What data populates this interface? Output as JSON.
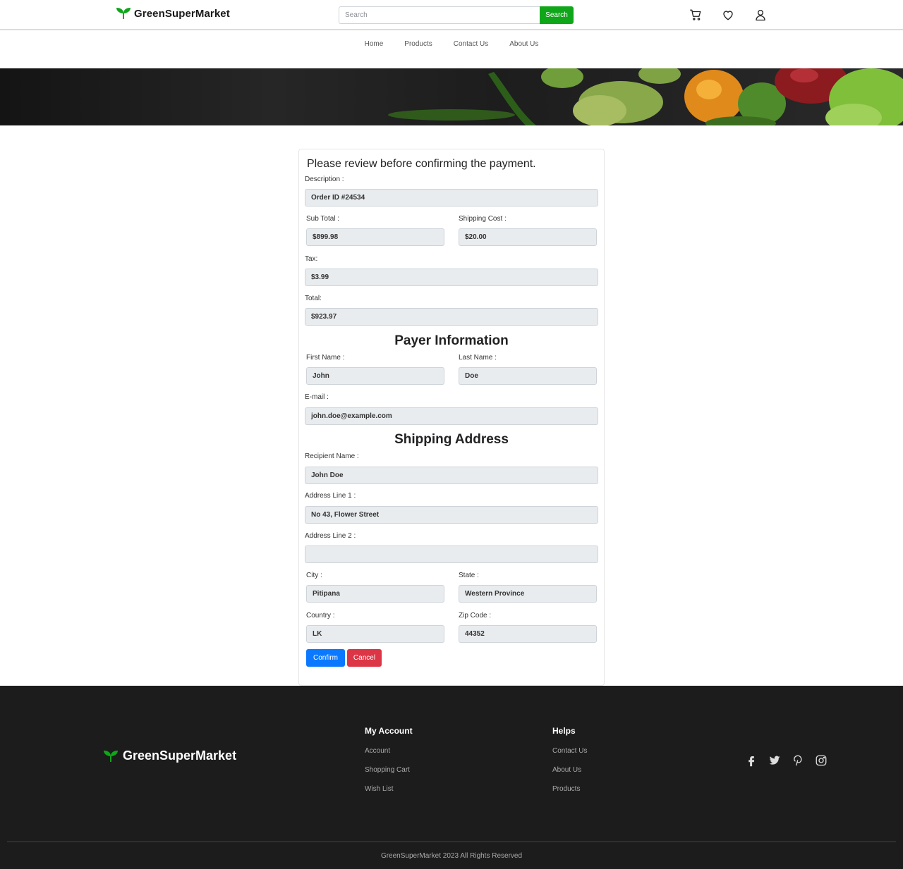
{
  "header": {
    "brand": "GreenSuperMarket",
    "search_placeholder": "Search",
    "search_button": "Search",
    "icons": [
      "cart-icon",
      "heart-icon",
      "user-icon"
    ]
  },
  "nav": {
    "items": [
      "Home",
      "Products",
      "Contact Us",
      "About Us"
    ]
  },
  "review": {
    "title": "Please review before confirming the payment.",
    "description_label": "Description :",
    "description_value": "Order ID #24534",
    "subtotal_label": "Sub Total :",
    "subtotal_value": "$899.98",
    "shipping_label": "Shipping Cost :",
    "shipping_value": "$20.00",
    "tax_label": "Tax:",
    "tax_value": "$3.99",
    "total_label": "Total:",
    "total_value": "$923.97"
  },
  "payer": {
    "title": "Payer Information",
    "first_name_label": "First Name :",
    "first_name_value": "John",
    "last_name_label": "Last Name :",
    "last_name_value": "Doe",
    "email_label": "E-mail :",
    "email_value": "john.doe@example.com"
  },
  "shipping": {
    "title": "Shipping Address",
    "recipient_label": "Recipient Name :",
    "recipient_value": "John Doe",
    "address1_label": "Address Line 1 :",
    "address1_value": "No 43, Flower Street",
    "address2_label": "Address Line 2 :",
    "address2_value": "",
    "city_label": "City :",
    "city_value": "Pitipana",
    "state_label": "State :",
    "state_value": "Western Province",
    "country_label": "Country :",
    "country_value": "LK",
    "zip_label": "Zip Code :",
    "zip_value": "44352"
  },
  "actions": {
    "confirm": "Confirm",
    "cancel": "Cancel"
  },
  "colors": {
    "brand_green": "#10a61a",
    "confirm_blue": "#0b79ff",
    "cancel_red": "#dc3545",
    "footer_bg": "#1c1c1c"
  },
  "footer": {
    "brand": "GreenSuperMarket",
    "my_account": {
      "title": "My Account",
      "links": [
        "Account",
        "Shopping Cart",
        "Wish List"
      ]
    },
    "helps": {
      "title": "Helps",
      "links": [
        "Contact Us",
        "About Us",
        "Products"
      ]
    },
    "social_icons": [
      "facebook-icon",
      "twitter-icon",
      "pinterest-icon",
      "instagram-icon"
    ],
    "copyright": "GreenSuperMarket 2023 All Rights Reserved"
  }
}
